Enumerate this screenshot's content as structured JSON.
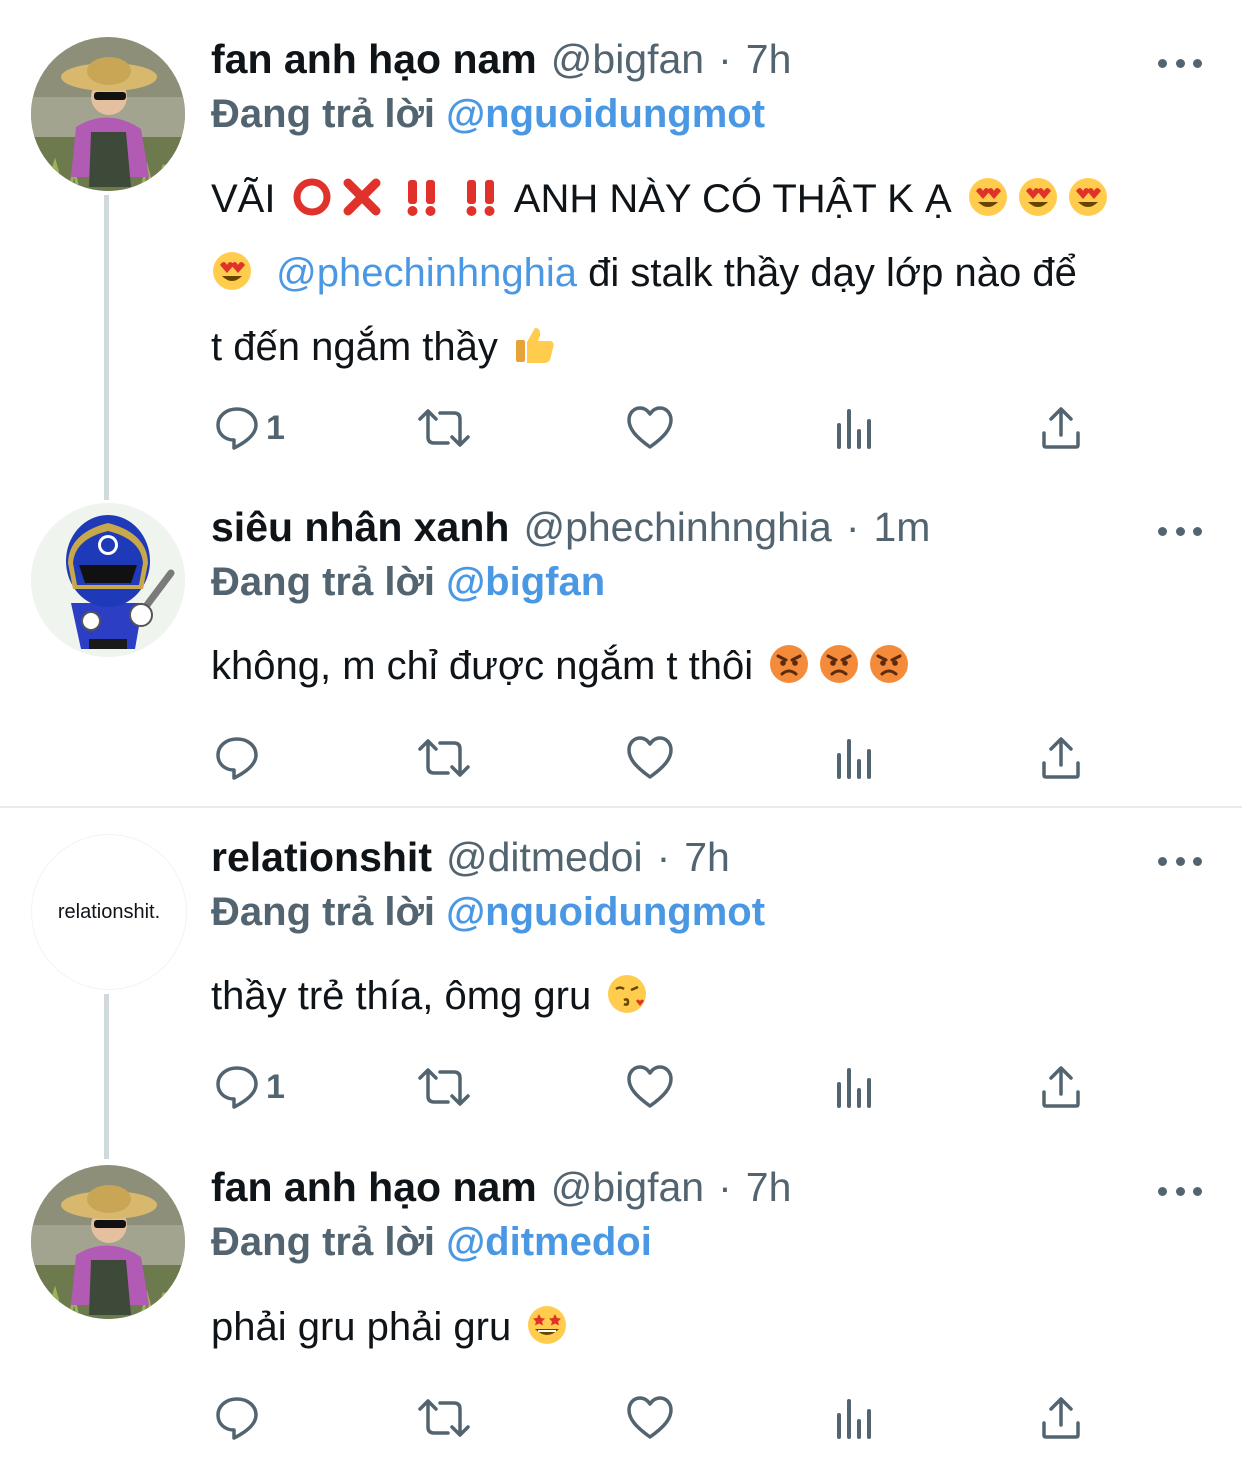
{
  "replying_prefix": "Đang trả lời",
  "tweets": [
    {
      "name": "fan anh hạo nam",
      "handle": "@bigfan",
      "sep": "·",
      "time": "7h",
      "reply_to": "@nguoidungmot",
      "text": {
        "a": "VÃI",
        "b": "ANH NÀY CÓ THẬT K Ạ",
        "mention": "@phechinhnghia",
        "c": "đi stalk thầy dạy lớp nào để",
        "d": "t đến ngắm thầy"
      },
      "reply_count": "1"
    },
    {
      "name": "siêu nhân xanh",
      "handle": "@phechinhnghia",
      "sep": "·",
      "time": "1m",
      "reply_to": "@bigfan",
      "text": "không, m chỉ được ngắm t thôi",
      "reply_count": ""
    },
    {
      "name": "relationshit",
      "handle": "@ditmedoi",
      "sep": "·",
      "time": "7h",
      "reply_to": "@nguoidungmot",
      "avatar_text": "relationshit.",
      "text": "thầy trẻ thía, ômg gru",
      "reply_count": "1"
    },
    {
      "name": "fan anh hạo nam",
      "handle": "@bigfan",
      "sep": "·",
      "time": "7h",
      "reply_to": "@ditmedoi",
      "text": "phải gru phải gru",
      "reply_count": ""
    }
  ],
  "colors": {
    "text": "#0f1419",
    "secondary": "#536471",
    "link": "#4a98e4",
    "thread": "#cfd9de"
  }
}
